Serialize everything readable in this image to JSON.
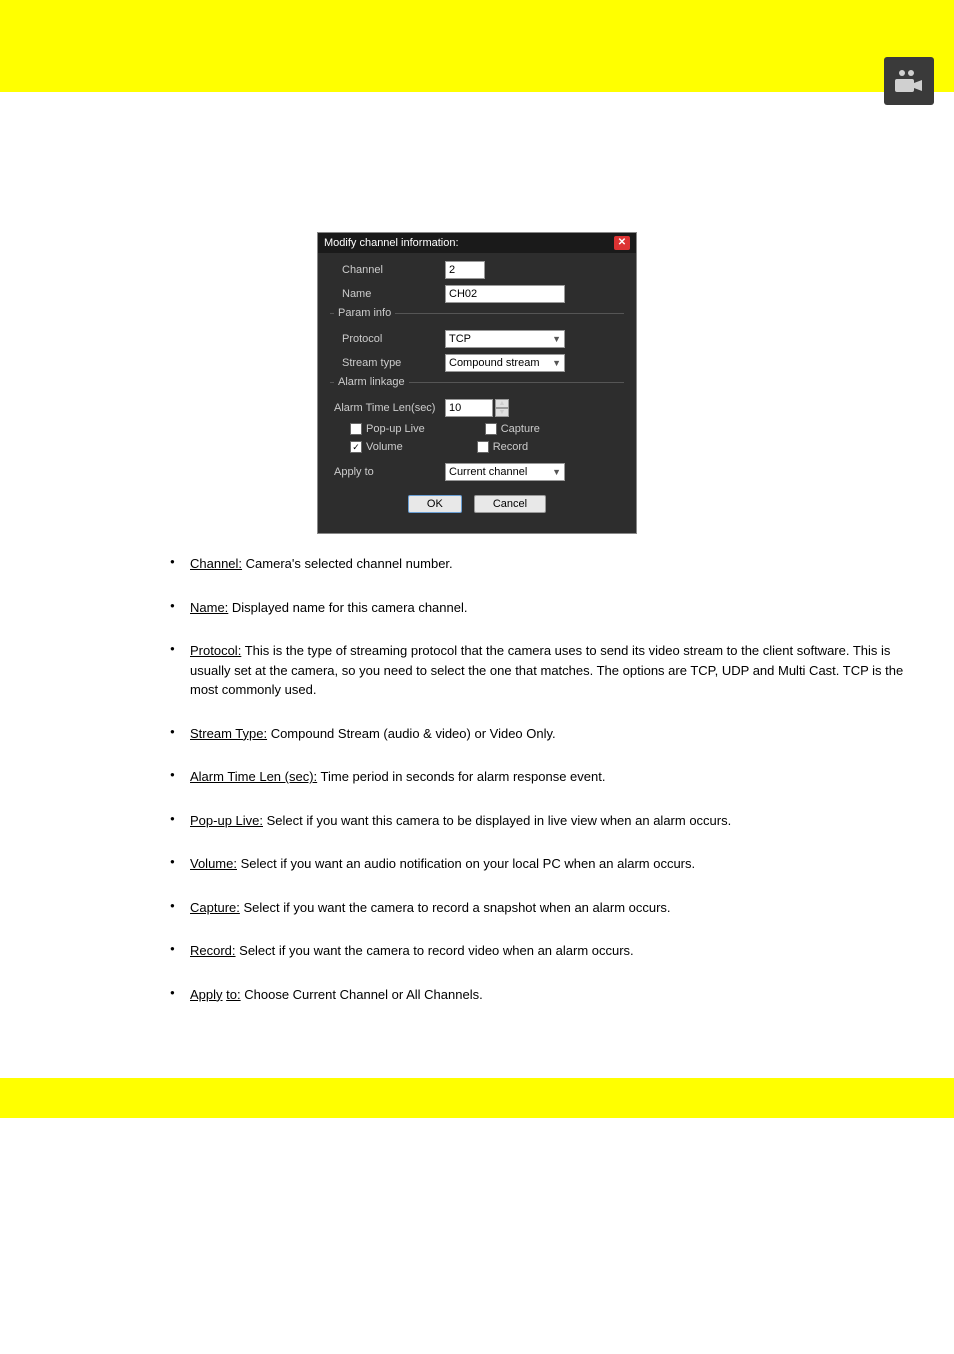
{
  "header": {
    "icon_name": "camera-icon"
  },
  "dialog": {
    "title": "Modify channel information:",
    "channel": {
      "label": "Channel",
      "value": "2"
    },
    "name": {
      "label": "Name",
      "value": "CH02"
    },
    "param_info": {
      "label": "Param info",
      "protocol": {
        "label": "Protocol",
        "value": "TCP"
      },
      "stream_type": {
        "label": "Stream type",
        "value": "Compound stream"
      }
    },
    "alarm_linkage": {
      "label": "Alarm linkage",
      "alarm_time_len": {
        "label": "Alarm Time Len(sec)",
        "value": "10"
      },
      "popup_live": {
        "label": "Pop-up Live",
        "checked": false
      },
      "capture": {
        "label": "Capture",
        "checked": false
      },
      "volume": {
        "label": "Volume",
        "checked": true
      },
      "record": {
        "label": "Record",
        "checked": false
      }
    },
    "apply_to": {
      "label": "Apply to",
      "value": "Current channel"
    },
    "buttons": {
      "ok": "OK",
      "cancel": "Cancel"
    }
  },
  "bullets": {
    "channel": {
      "term": "Channel:",
      "desc": " Camera's selected channel number."
    },
    "name": {
      "term": "Name:",
      "desc": " Displayed name for this camera channel."
    },
    "protocol": {
      "term": "Protocol:",
      "desc": " This is the type of streaming protocol that the camera uses to send its video stream to the client software. This is usually set at the camera, so you need to select the one that matches. The options are TCP, UDP and Multi Cast. TCP is the most commonly used."
    },
    "stream_type": {
      "term": "Stream Type:",
      "desc": " Compound Stream (audio & video) or Video Only."
    },
    "alarm_time": {
      "term": "Alarm Time Len (sec):",
      "desc": " Time period in seconds for alarm response event."
    },
    "popup_live": {
      "term": "Pop-up Live:",
      "desc": " Select if you want this camera to be displayed in live view when an alarm occurs."
    },
    "volume": {
      "term": "Volume:",
      "desc": " Select if you want an audio notification on your local PC when an alarm occurs."
    },
    "capture": {
      "term": "Capture:",
      "desc": " Select if you want the camera to record a snapshot when an alarm occurs."
    },
    "record": {
      "term": "Record:",
      "desc": " Select if you want the camera to record video when an alarm occurs."
    },
    "apply_to": {
      "term": "Apply",
      "term2": "to:",
      "desc": " Choose Current Channel or All Channels."
    }
  }
}
